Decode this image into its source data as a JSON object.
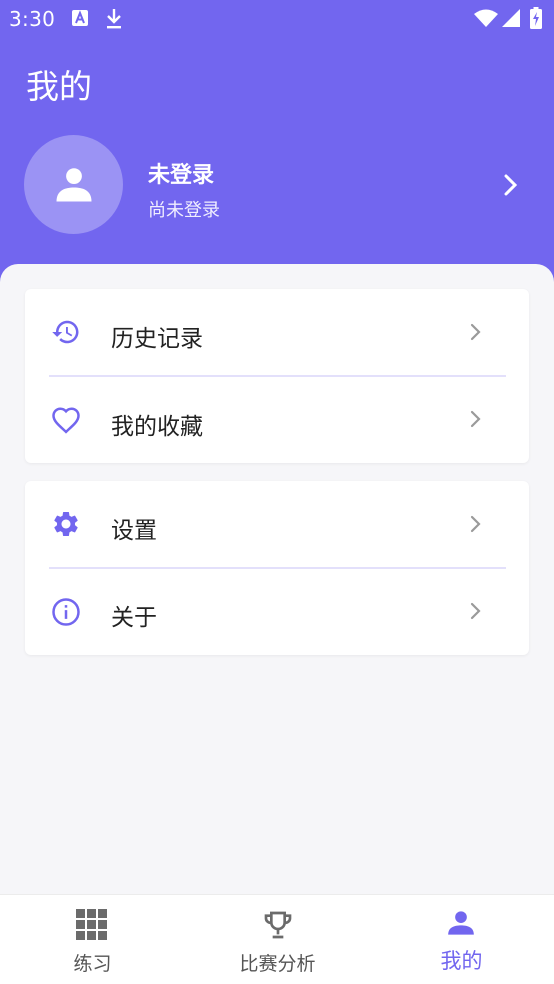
{
  "status_bar": {
    "time": "3:30",
    "icons": [
      "a-notification-icon",
      "download-icon",
      "wifi-icon",
      "signal-icon",
      "battery-charging-icon"
    ]
  },
  "header": {
    "title": "我的",
    "background_color": "#7266ef"
  },
  "profile": {
    "name": "未登录",
    "subtitle": "尚未登录",
    "avatar_icon": "user-icon"
  },
  "menu_groups": [
    {
      "items": [
        {
          "label": "历史记录",
          "icon": "history-icon"
        },
        {
          "label": "我的收藏",
          "icon": "heart-icon"
        }
      ]
    },
    {
      "items": [
        {
          "label": "设置",
          "icon": "gear-icon"
        },
        {
          "label": "关于",
          "icon": "info-icon"
        }
      ]
    }
  ],
  "tabbar": {
    "tabs": [
      {
        "label": "练习",
        "icon": "grid-icon",
        "active": false
      },
      {
        "label": "比赛分析",
        "icon": "trophy-icon",
        "active": false
      },
      {
        "label": "我的",
        "icon": "user-icon",
        "active": true
      }
    ],
    "active_color": "#7266ef",
    "inactive_color": "#555555"
  }
}
